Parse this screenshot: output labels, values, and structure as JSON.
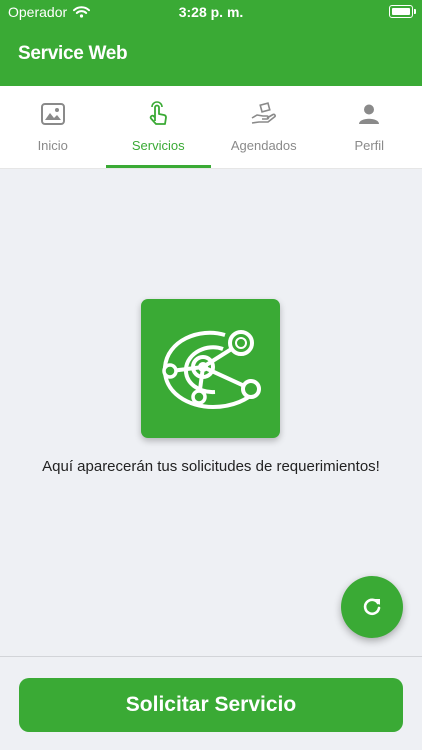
{
  "status_bar": {
    "carrier": "Operador",
    "time": "3:28 p. m."
  },
  "header": {
    "title": "Service Web"
  },
  "tabs": [
    {
      "label": "Inicio",
      "icon": "image-icon",
      "active": false
    },
    {
      "label": "Servicios",
      "icon": "touch-hand-icon",
      "active": true
    },
    {
      "label": "Agendados",
      "icon": "hand-package-icon",
      "active": false
    },
    {
      "label": "Perfil",
      "icon": "person-icon",
      "active": false
    }
  ],
  "main": {
    "logo_icon": "network-target-logo",
    "empty_message": "Aquí aparecerán tus solicitudes de requerimientos!"
  },
  "fab": {
    "icon": "refresh-icon"
  },
  "footer": {
    "cta_label": "Solicitar Servicio"
  },
  "colors": {
    "primary": "#3aaa35",
    "background": "#eef0f4",
    "tab_inactive": "#8a8a8a"
  }
}
